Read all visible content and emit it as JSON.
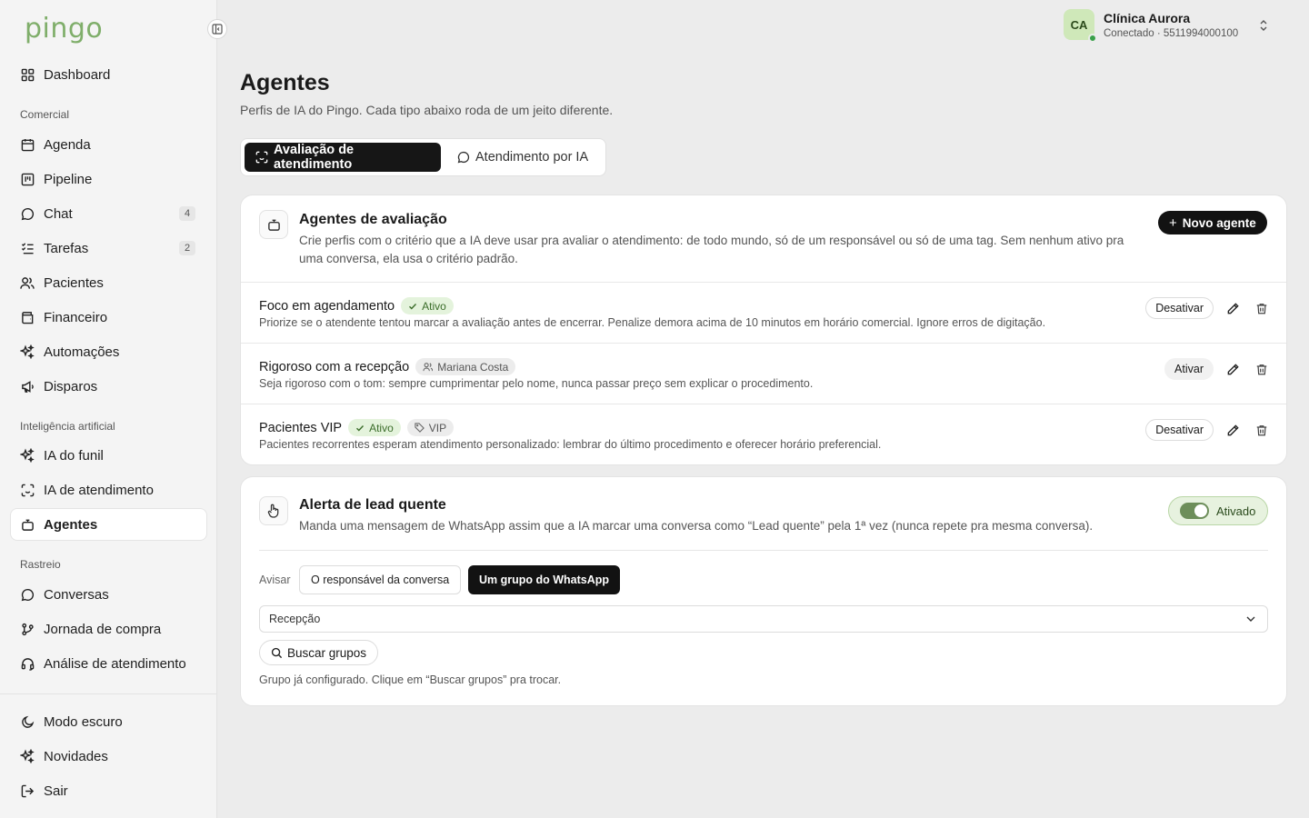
{
  "brand": {
    "logo": "pingo"
  },
  "sidebar": {
    "items": [
      {
        "label": "Dashboard",
        "icon": "dashboard-icon"
      },
      {
        "label": "Agenda",
        "icon": "calendar-icon"
      },
      {
        "label": "Pipeline",
        "icon": "kanban-icon"
      },
      {
        "label": "Chat",
        "icon": "chat-icon",
        "badge": "4"
      },
      {
        "label": "Tarefas",
        "icon": "tasks-icon",
        "badge": "2"
      },
      {
        "label": "Pacientes",
        "icon": "users-icon"
      },
      {
        "label": "Financeiro",
        "icon": "wallet-icon"
      },
      {
        "label": "Automações",
        "icon": "sparkles-icon"
      },
      {
        "label": "Disparos",
        "icon": "megaphone-icon"
      },
      {
        "label": "IA do funil",
        "icon": "sparkles-icon"
      },
      {
        "label": "IA de atendimento",
        "icon": "scan-face-icon"
      },
      {
        "label": "Agentes",
        "icon": "bot-icon",
        "active": true
      },
      {
        "label": "Conversas",
        "icon": "chat-icon"
      },
      {
        "label": "Jornada de compra",
        "icon": "branch-icon"
      },
      {
        "label": "Análise de atendimento",
        "icon": "headset-icon"
      }
    ],
    "sections": {
      "comercial": "Comercial",
      "ia": "Inteligência artificial",
      "rastreio": "Rastreio"
    },
    "footer": [
      {
        "label": "Modo escuro",
        "icon": "moon-icon"
      },
      {
        "label": "Novidades",
        "icon": "sparkles-icon"
      },
      {
        "label": "Sair",
        "icon": "logout-icon"
      }
    ]
  },
  "account": {
    "initials": "CA",
    "name": "Clínica Aurora",
    "status": "Conectado · 5511994000100"
  },
  "page": {
    "title": "Agentes",
    "subtitle": "Perfis de IA do Pingo. Cada tipo abaixo roda de um jeito diferente."
  },
  "tabs": [
    {
      "label": "Avaliação de atendimento",
      "active": true
    },
    {
      "label": "Atendimento por IA",
      "active": false
    }
  ],
  "evaluation": {
    "title": "Agentes de avaliação",
    "description": "Crie perfis com o critério que a IA deve usar pra avaliar o atendimento: de todo mundo, só de um responsável ou só de uma tag. Sem nenhum ativo pra uma conversa, ela usa o critério padrão.",
    "new_button": "Novo agente",
    "agents": [
      {
        "name": "Foco em agendamento",
        "tags": [
          {
            "label": "Ativo",
            "kind": "status"
          }
        ],
        "description": "Priorize se o atendente tentou marcar a avaliação antes de encerrar. Penalize demora acima de 10 minutos em horário comercial. Ignore erros de digitação.",
        "action": "Desativar"
      },
      {
        "name": "Rigoroso com a recepção",
        "tags": [
          {
            "label": "Mariana Costa",
            "kind": "user"
          }
        ],
        "description": "Seja rigoroso com o tom: sempre cumprimentar pelo nome, nunca passar preço sem explicar o procedimento.",
        "action": "Ativar"
      },
      {
        "name": "Pacientes VIP",
        "tags": [
          {
            "label": "Ativo",
            "kind": "status"
          },
          {
            "label": "VIP",
            "kind": "tag"
          }
        ],
        "description": "Pacientes recorrentes esperam atendimento personalizado: lembrar do último procedimento e oferecer horário preferencial.",
        "action": "Desativar"
      }
    ]
  },
  "hot_lead": {
    "title": "Alerta de lead quente",
    "description": "Manda uma mensagem de WhatsApp assim que a IA marcar uma conversa como “Lead quente” pela 1ª vez (nunca repete pra mesma conversa).",
    "toggle_label": "Ativado",
    "toggle_on": true,
    "notify_label": "Avisar",
    "options": [
      "O responsável da conversa",
      "Um grupo do WhatsApp"
    ],
    "selected_option": "Um grupo do WhatsApp",
    "group_value": "Recepção",
    "search_button": "Buscar grupos",
    "helper": "Grupo já configurado. Clique em “Buscar grupos” pra trocar."
  },
  "colors": {
    "accent": "#7fae6a",
    "dark": "#121212",
    "active_tag_bg": "#e4f3dc",
    "online": "#3aa14a"
  }
}
